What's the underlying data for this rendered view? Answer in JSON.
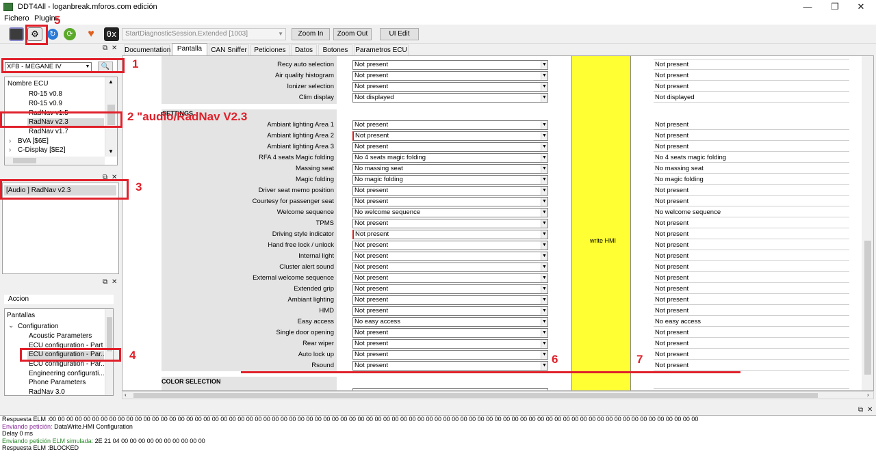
{
  "window": {
    "title": "DDT4All - loganbreak.mforos.com edición",
    "minimize": "—",
    "maximize": "❐",
    "close": "✕"
  },
  "menu": {
    "items": [
      "Fichero",
      "Plugins"
    ]
  },
  "toolbar": {
    "session_value": "StartDiagnosticSession.Extended [1003]",
    "zoom_in": "Zoom In",
    "zoom_out": "Zoom Out",
    "ui_edit": "UI Edit",
    "hex_label": "0x"
  },
  "ecu_selector": {
    "vehicle": "XFB - MEGANE IV"
  },
  "ecu_tree": {
    "header": "Nombre ECU",
    "items": [
      "R0-15 v0.8",
      "R0-15 v0.9",
      "RadNav v1.5",
      "RadNav v2.3",
      "RadNav v1.7"
    ],
    "groups": [
      "BVA [$6E]",
      "C-Display [$E2]"
    ],
    "selected_index": 3
  },
  "ecu_panel": {
    "selected": "[Audio ] RadNav v2.3"
  },
  "screens_panel": {
    "accion": "Accion",
    "root": "Pantallas",
    "folder": "Configuration",
    "items": [
      "Acoustic Parameters",
      "ECU configuration - Part I",
      "ECU configuration - Par...",
      "ECU configuration - Par...",
      "Engineering configurati...",
      "Phone Parameters",
      "RadNav 3.0"
    ],
    "selected_index": 2
  },
  "tabs": [
    "Documentation",
    "Pantalla",
    "CAN Sniffer",
    "Peticiones",
    "Datos",
    "Botones",
    "Parametros ECU"
  ],
  "active_tab": "Pantalla",
  "form": {
    "top_rows": [
      {
        "label": "Recy auto selection",
        "value": "Not present",
        "readback": "Not present"
      },
      {
        "label": "Air quality histogram",
        "value": "Not present",
        "readback": "Not present"
      },
      {
        "label": "Ionizer selection",
        "value": "Not present",
        "readback": "Not present"
      },
      {
        "label": "Clim display",
        "value": "Not displayed",
        "readback": "Not displayed"
      }
    ],
    "settings_title": "SETTINGS",
    "settings_rows": [
      {
        "label": "Ambiant lighting  Area 1",
        "value": "Not present",
        "readback": "Not present"
      },
      {
        "label": "Ambiant lighting  Area 2",
        "value": "Not present",
        "readback": "Not present"
      },
      {
        "label": "Ambiant lighting  Area 3",
        "value": "Not present",
        "readback": "Not present"
      },
      {
        "label": "RFA 4 seats Magic folding",
        "value": "No 4 seats magic folding",
        "readback": "No 4 seats magic folding"
      },
      {
        "label": "Massing seat",
        "value": "No massing seat",
        "readback": "No massing seat"
      },
      {
        "label": "Magic folding",
        "value": "No magic folding",
        "readback": "No magic folding"
      },
      {
        "label": "Driver seat memo position",
        "value": "Not present",
        "readback": "Not present"
      },
      {
        "label": "Courtesy for passenger seat",
        "value": "Not present",
        "readback": "Not present"
      },
      {
        "label": "Welcome sequence",
        "value": "No welcome sequence",
        "readback": "No welcome sequence"
      },
      {
        "label": "TPMS",
        "value": "Not present",
        "readback": "Not present"
      },
      {
        "label": "Driving style indicator",
        "value": "Not present",
        "readback": "Not present"
      },
      {
        "label": "Hand free lock / unlock",
        "value": "Not present",
        "readback": "Not present"
      },
      {
        "label": "Internal light",
        "value": "Not present",
        "readback": "Not present"
      },
      {
        "label": "Cluster alert sound",
        "value": "Not present",
        "readback": "Not present"
      },
      {
        "label": "External welcome sequence",
        "value": "Not present",
        "readback": "Not present"
      },
      {
        "label": "Extended grip",
        "value": "Not present",
        "readback": "Not present"
      },
      {
        "label": "Ambiant lighting",
        "value": "Not present",
        "readback": "Not present"
      },
      {
        "label": "HMD",
        "value": "Not present",
        "readback": "Not present"
      },
      {
        "label": "Easy access",
        "value": "No easy access",
        "readback": "No easy access"
      },
      {
        "label": "Single door opening",
        "value": "Not present",
        "readback": "Not present"
      },
      {
        "label": "Rear wiper",
        "value": "Not present",
        "readback": "Not present"
      },
      {
        "label": "Auto lock up",
        "value": "Not present",
        "readback": "Not present"
      },
      {
        "label": "Rsound",
        "value": "Not present",
        "readback": "Not present"
      }
    ],
    "red_marked_rows": [
      1,
      10
    ],
    "color_section": "COLOR SELECTION",
    "write_button": "write HMI",
    "write_color": "#ffff33"
  },
  "log": {
    "lines": [
      {
        "prefix": "Respuesta ELM :",
        "text": "00 00 00 00 00 00 00 00 00 00 00 00 00 00 00 00 00 00 00 00 00 00 00 00 00 00 00 00 00 00 00 00 00 00 00 00 00 00 00 00 00 00 00 00 00 00 00 00 00 00 00 00 00 00 00 00 00 00 00 00 00 00 00 00 00 00 00 00 00 00 00 00 00 00 00 00",
        "color": "#000000"
      },
      {
        "prefix": "Enviando petición:",
        "text": " DataWrite.HMI Configuration",
        "color": "#8a2a9a"
      },
      {
        "prefix": "Delay 0 ms",
        "text": "",
        "color": "#000000"
      },
      {
        "prefix": "Enviando petición ELM simulada:",
        "text": " 2E 21 04 00 00 00 00 00 00 00 00 00 00",
        "color": "#2a8a2a"
      },
      {
        "prefix": "Respuesta ELM :",
        "text": "BLOCKED",
        "color": "#000000"
      }
    ]
  },
  "annotations": {
    "labels": [
      "1",
      "2 \"audio/RadNav V2.3",
      "3",
      "4",
      "5",
      "6",
      "7"
    ],
    "color": "#e0202a"
  }
}
